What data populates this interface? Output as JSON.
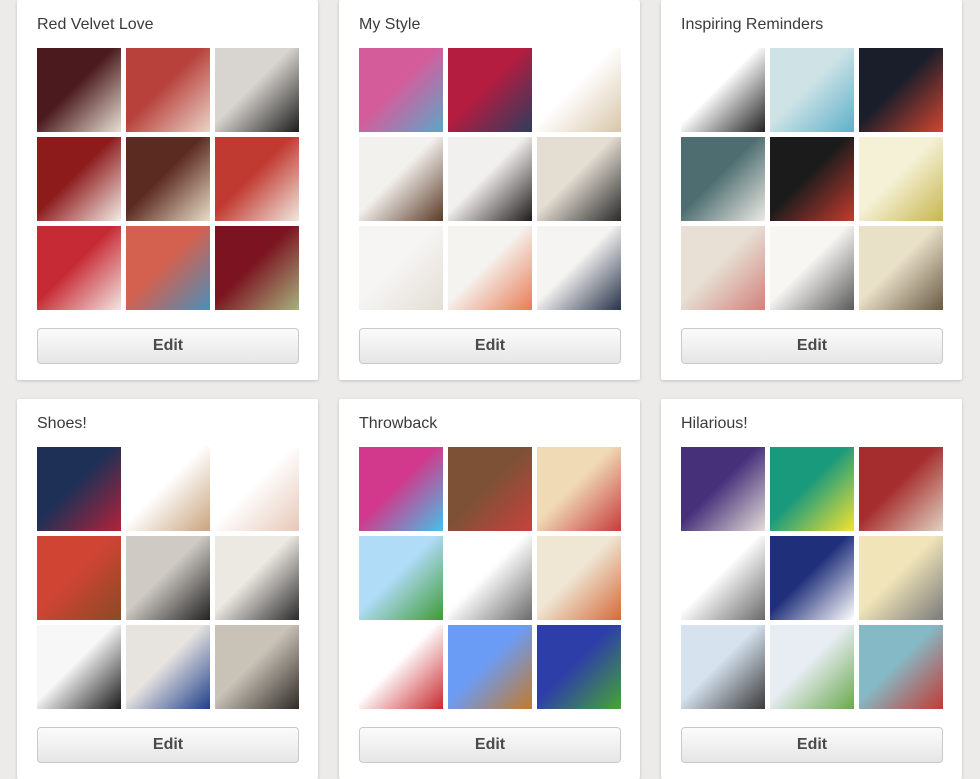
{
  "boards": [
    {
      "title": "Red Velvet Love",
      "edit_label": "Edit",
      "thumbs": [
        {
          "name": "cupcake-palette-photo",
          "colors": [
            "#4a1a1e",
            "#e9e0d2"
          ]
        },
        {
          "name": "crinkle-cookies-photo",
          "colors": [
            "#b8413b",
            "#ead4c8"
          ]
        },
        {
          "name": "poe-raven-cookie-photo",
          "colors": [
            "#d8d4cf",
            "#1c1c1c"
          ]
        },
        {
          "name": "red-velvet-cake-photo",
          "colors": [
            "#8e1b1c",
            "#f2ece6"
          ]
        },
        {
          "name": "layer-bars-photo",
          "colors": [
            "#5b2b22",
            "#e9ddc8"
          ]
        },
        {
          "name": "cheesecake-slice-photo",
          "colors": [
            "#c13a31",
            "#f0e8df"
          ]
        },
        {
          "name": "swirl-dessert-photo",
          "colors": [
            "#c62a34",
            "#f1e6e1"
          ]
        },
        {
          "name": "red-dip-bowl-photo",
          "colors": [
            "#d4604f",
            "#4b8fb8"
          ]
        },
        {
          "name": "cake-slice-plate-photo",
          "colors": [
            "#7b1420",
            "#a7b27d"
          ]
        }
      ]
    },
    {
      "title": "My Style",
      "edit_label": "Edit",
      "thumbs": [
        {
          "name": "scarves-rack-photo",
          "colors": [
            "#d55c9b",
            "#5aa7c7"
          ]
        },
        {
          "name": "red-clutch-photo",
          "colors": [
            "#b41c40",
            "#2f3d5e"
          ]
        },
        {
          "name": "cream-dress-photo",
          "colors": [
            "#ffffff",
            "#d8c6a8"
          ]
        },
        {
          "name": "boat-shoes-photo",
          "colors": [
            "#f3f1ee",
            "#5a3a26"
          ]
        },
        {
          "name": "black-heels-photo",
          "colors": [
            "#f2f0ee",
            "#1f1b1b"
          ]
        },
        {
          "name": "cream-blazer-photo",
          "colors": [
            "#e4ddd2",
            "#2a2a2a"
          ]
        },
        {
          "name": "white-suit-photo",
          "colors": [
            "#f6f5f3",
            "#e3ded5"
          ]
        },
        {
          "name": "outfit-flatlay-photo",
          "colors": [
            "#f5f3f0",
            "#e87c55"
          ]
        },
        {
          "name": "dark-jeans-photo",
          "colors": [
            "#f5f4f2",
            "#27334a"
          ]
        }
      ]
    },
    {
      "title": "Inspiring Reminders",
      "edit_label": "Edit",
      "thumbs": [
        {
          "name": "quote-list-text-photo",
          "colors": [
            "#ffffff",
            "#222222"
          ]
        },
        {
          "name": "carpe-quote-card-photo",
          "colors": [
            "#cfe3e6",
            "#5cb1c9"
          ]
        },
        {
          "name": "show-god-your-faith-photo",
          "colors": [
            "#1a1e2a",
            "#d24530"
          ]
        },
        {
          "name": "coffee-cup-quote-photo",
          "colors": [
            "#4e6d70",
            "#ebeae3"
          ]
        },
        {
          "name": "word-cloud-photo",
          "colors": [
            "#1b1b1b",
            "#c43b2f"
          ]
        },
        {
          "name": "decorating-mantras-photo",
          "colors": [
            "#f4f1d7",
            "#c8b64e"
          ]
        },
        {
          "name": "fashion-sketch-photo",
          "colors": [
            "#e8dfd5",
            "#d0827a"
          ]
        },
        {
          "name": "changed-reduced-quote-photo",
          "colors": [
            "#f7f6f3",
            "#5a5a5a"
          ]
        },
        {
          "name": "strong-quote-paper-photo",
          "colors": [
            "#e9e0c8",
            "#6a5a44"
          ]
        }
      ]
    },
    {
      "title": "Shoes!",
      "edit_label": "Edit",
      "thumbs": [
        {
          "name": "glitter-heels-photo",
          "colors": [
            "#1e3056",
            "#b3233a"
          ]
        },
        {
          "name": "wedge-pumps-photo",
          "colors": [
            "#ffffff",
            "#c9a37c"
          ]
        },
        {
          "name": "leopard-peeptoe-photo",
          "colors": [
            "#ffffff",
            "#e7c8b8"
          ]
        },
        {
          "name": "tassel-sandals-photo",
          "colors": [
            "#d04434",
            "#8a4a25"
          ]
        },
        {
          "name": "strappy-black-heels-photo",
          "colors": [
            "#cfcac4",
            "#222222"
          ]
        },
        {
          "name": "ankle-boots-photo",
          "colors": [
            "#ece8e2",
            "#2a2a2a"
          ]
        },
        {
          "name": "studded-black-pumps-photo",
          "colors": [
            "#f7f7f7",
            "#1a1a1a"
          ]
        },
        {
          "name": "blue-suede-pumps-photo",
          "colors": [
            "#e7e4e0",
            "#1f3f8a"
          ]
        },
        {
          "name": "legs-street-photo",
          "colors": [
            "#c9c2b7",
            "#2f2a26"
          ]
        }
      ]
    },
    {
      "title": "Throwback",
      "edit_label": "Edit",
      "thumbs": [
        {
          "name": "lisa-frank-art-photo",
          "colors": [
            "#d2388c",
            "#46c0e8"
          ]
        },
        {
          "name": "kids-portrait-photo",
          "colors": [
            "#7c5136",
            "#c8423e"
          ]
        },
        {
          "name": "sweet-valley-high-cover-photo",
          "colors": [
            "#f0d9b5",
            "#c63b3b"
          ]
        },
        {
          "name": "pixel-game-scene-photo",
          "colors": [
            "#b0dcf7",
            "#3f9b37"
          ]
        },
        {
          "name": "nes-controller-photo",
          "colors": [
            "#ffffff",
            "#6b6b6b"
          ]
        },
        {
          "name": "trading-cards-grid-photo",
          "colors": [
            "#efe6d4",
            "#d56a3a"
          ]
        },
        {
          "name": "paper-mario-meme-photo",
          "colors": [
            "#ffffff",
            "#c8282c"
          ]
        },
        {
          "name": "mario-level-photo",
          "colors": [
            "#6b9cf5",
            "#c27a2c"
          ]
        },
        {
          "name": "sonic-level-photo",
          "colors": [
            "#2d3ea8",
            "#47a436"
          ]
        }
      ]
    },
    {
      "title": "Hilarious!",
      "edit_label": "Edit",
      "thumbs": [
        {
          "name": "funny-kid-photo",
          "colors": [
            "#46307a",
            "#e3ddd8"
          ]
        },
        {
          "name": "i-would-date-you-meme-photo",
          "colors": [
            "#1a9a7d",
            "#f4e32f"
          ]
        },
        {
          "name": "disobedience-meme-photo",
          "colors": [
            "#a52d2d",
            "#e0d2c0"
          ]
        },
        {
          "name": "comic-sketch-photo",
          "colors": [
            "#ffffff",
            "#6a6a6a"
          ]
        },
        {
          "name": "kids-today-floppy-meme-photo",
          "colors": [
            "#1f2f7a",
            "#ffffff"
          ]
        },
        {
          "name": "rage-comic-panels-photo",
          "colors": [
            "#f0e4b8",
            "#7a7a7a"
          ]
        },
        {
          "name": "hard-drive-comic-photo",
          "colors": [
            "#d6e3ef",
            "#3a3a3a"
          ]
        },
        {
          "name": "text-message-screenshot-photo",
          "colors": [
            "#e8edf3",
            "#6aa84f"
          ]
        },
        {
          "name": "retro-pinup-meme-photo",
          "colors": [
            "#86b9c6",
            "#c23b34"
          ]
        }
      ]
    }
  ]
}
